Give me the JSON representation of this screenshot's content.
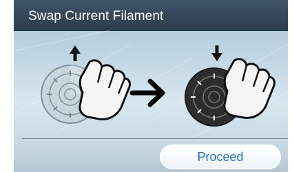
{
  "header": {
    "title": "Swap Current Filament"
  },
  "actions": {
    "proceed_label": "Proceed"
  },
  "icons": {
    "left_dial": "filament-dial-release-icon",
    "left_arrow": "arrow-up-icon",
    "hand_left": "hand-icon",
    "arrow": "arrow-right-icon",
    "right_dial": "filament-dial-press-icon",
    "right_arrow": "arrow-down-icon",
    "hand_right": "hand-icon"
  },
  "colors": {
    "header_bg": "#34495c",
    "button_text": "#1d6fd3",
    "dial_light": "#b9c6cf",
    "dial_dark": "#2a2a2a"
  }
}
